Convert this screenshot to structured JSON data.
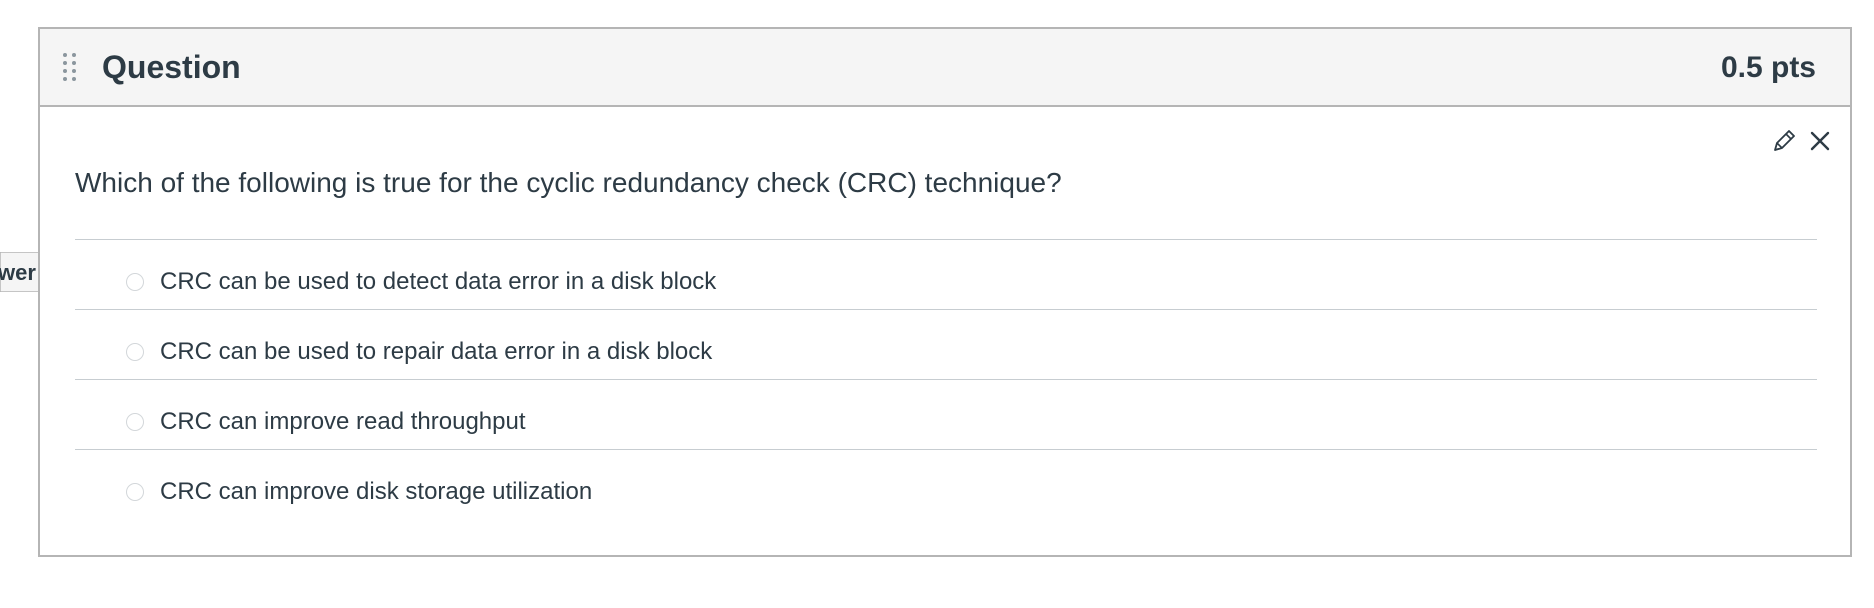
{
  "question": {
    "title": "Question",
    "points": "0.5 pts",
    "text": "Which of the following is true for the cyclic redundancy check (CRC) technique?",
    "answers": [
      {
        "label": "CRC can be used to detect data error in a disk block"
      },
      {
        "label": "CRC can be used to repair data error in a disk block"
      },
      {
        "label": "CRC can improve read throughput"
      },
      {
        "label": "CRC can improve disk storage utilization"
      }
    ],
    "answer_flag_label": "wer",
    "icons": {
      "drag": "drag-handle-icon",
      "edit": "pencil-icon",
      "delete": "close-icon"
    }
  },
  "colors": {
    "text": "#2d3b45",
    "header_bg": "#f5f5f5",
    "border": "#b5b5b5",
    "divider": "#c7cdd1"
  }
}
